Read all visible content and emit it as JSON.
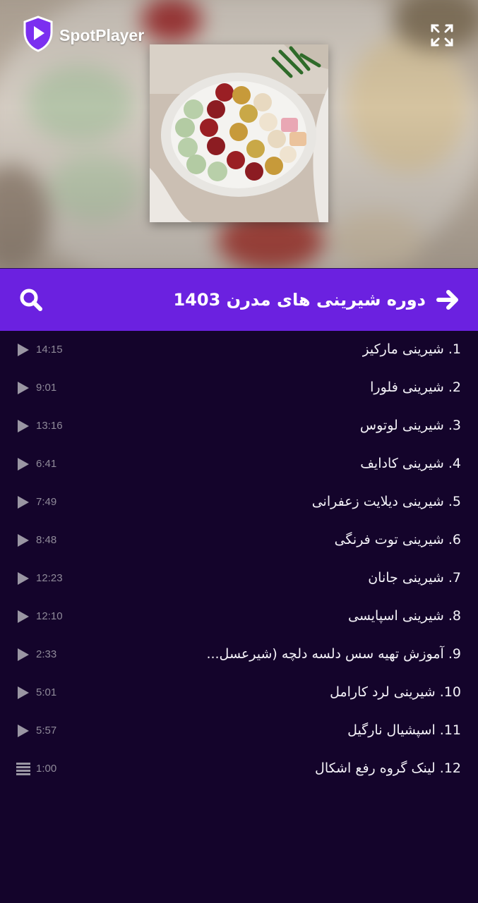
{
  "app": {
    "name": "SpotPlayer",
    "logo_icon": "shield-play-icon",
    "accent": "#7b2ff0"
  },
  "header": {
    "expand_icon": "expand-icon"
  },
  "course": {
    "title": "دوره شیرینی های مدرن 1403",
    "back_icon": "arrow-right-icon",
    "search_icon": "search-icon",
    "bar_color": "#6b21e0"
  },
  "playlist": {
    "background": "#14042b",
    "items": [
      {
        "title": "1. شیرینی مارکیز",
        "duration": "14:15",
        "icon": "play-icon"
      },
      {
        "title": "2. شیرینی فلورا",
        "duration": "9:01",
        "icon": "play-icon"
      },
      {
        "title": "3. شیرینی لوتوس",
        "duration": "13:16",
        "icon": "play-icon"
      },
      {
        "title": "4. شیرینی کادایف",
        "duration": "6:41",
        "icon": "play-icon"
      },
      {
        "title": "5. شیرینی دیلایت زعفرانی",
        "duration": "7:49",
        "icon": "play-icon"
      },
      {
        "title": "6. شیرینی توت فرنگی",
        "duration": "8:48",
        "icon": "play-icon"
      },
      {
        "title": "7. شیرینی جانان",
        "duration": "12:23",
        "icon": "play-icon"
      },
      {
        "title": "8. شیرینی اسپایسی",
        "duration": "12:10",
        "icon": "play-icon"
      },
      {
        "title": "9. آموزش تهیه سس دلسه دلچه (شیرعسل...",
        "duration": "2:33",
        "icon": "play-icon"
      },
      {
        "title": "10. شیرینی لرد کارامل",
        "duration": "5:01",
        "icon": "play-icon"
      },
      {
        "title": "11. اسپشیال نارگیل",
        "duration": "5:57",
        "icon": "play-icon"
      },
      {
        "title": "12. لینک گروه رفع اشکال",
        "duration": "1:00",
        "icon": "text-lines-icon"
      }
    ]
  }
}
